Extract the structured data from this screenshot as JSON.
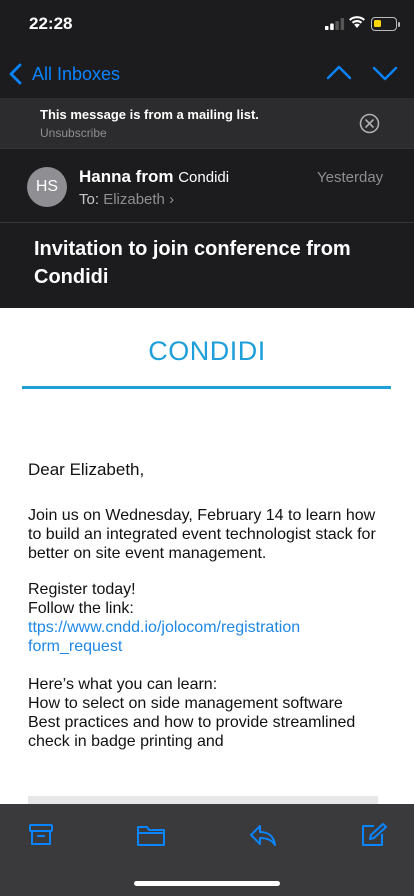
{
  "status_bar": {
    "time": "22:28",
    "icons": [
      "cellular-signal-icon",
      "wifi-icon",
      "battery-low-icon"
    ],
    "battery_color": "#ffd60a"
  },
  "nav": {
    "back_label": "All Inboxes",
    "icons": [
      "chevron-left-icon",
      "chevron-up-icon",
      "chevron-down-icon"
    ],
    "accent": "#0a84ff"
  },
  "banner": {
    "message": "This message is from a mailing list.",
    "unsubscribe": "Unsubscribe",
    "icon": "close-circle-icon"
  },
  "sender": {
    "initials": "HS",
    "name": "Hanna from",
    "company": "Condidi",
    "to_label": "To:",
    "recipient": "Elizabeth",
    "date": "Yesterday"
  },
  "subject": "Invitation to join conference from Condidi",
  "email": {
    "brand": "CONDIDI",
    "brand_color": "#1e9fd9",
    "greeting": "Dear Elizabeth,",
    "paragraph1": "Join us on Wednesday, February 14 to learn how to build an integrated event technologist stack for better on site event management.",
    "register_line1": "Register today!",
    "register_line2": "Follow the link:",
    "link": "ttps://www.cndd.io/jolocom/registration form_request",
    "learn_intro": "Here’s what you can learn:",
    "learn_item1": "How to select on side management software",
    "learn_item2": "Best practices and how to provide streamlined check in badge printing and"
  },
  "toolbar": {
    "icons": [
      "archive-icon",
      "folder-icon",
      "reply-icon",
      "compose-icon"
    ],
    "icon_color": "#0a84ff"
  }
}
